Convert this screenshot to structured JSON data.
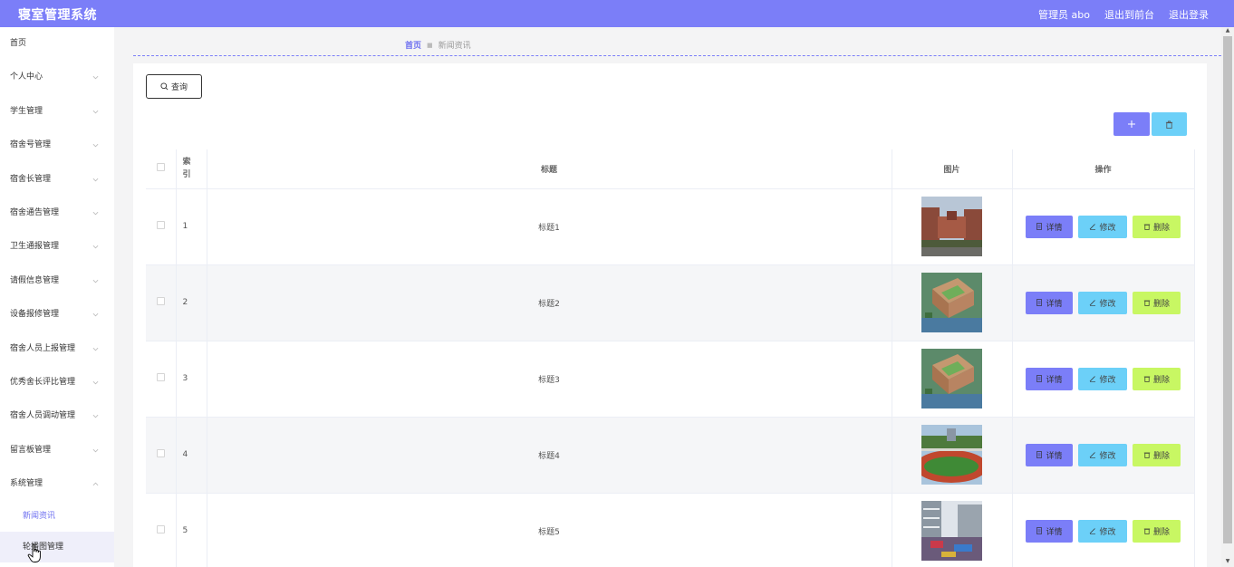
{
  "app": {
    "title": "寝室管理系统"
  },
  "header": {
    "user": "管理员 abo",
    "to_front": "退出到前台",
    "logout": "退出登录"
  },
  "sidebar": {
    "items": [
      {
        "label": "首页",
        "expandable": false
      },
      {
        "label": "个人中心",
        "expandable": true
      },
      {
        "label": "学生管理",
        "expandable": true
      },
      {
        "label": "宿舍号管理",
        "expandable": true
      },
      {
        "label": "宿舍长管理",
        "expandable": true
      },
      {
        "label": "宿舍通告管理",
        "expandable": true
      },
      {
        "label": "卫生通报管理",
        "expandable": true
      },
      {
        "label": "请假信息管理",
        "expandable": true
      },
      {
        "label": "设备报修管理",
        "expandable": true
      },
      {
        "label": "宿舍人员上报管理",
        "expandable": true
      },
      {
        "label": "优秀舍长评比管理",
        "expandable": true
      },
      {
        "label": "宿舍人员调动管理",
        "expandable": true
      },
      {
        "label": "留言板管理",
        "expandable": true
      },
      {
        "label": "系统管理",
        "expandable": true,
        "expanded": true
      }
    ],
    "subitems": [
      {
        "label": "新闻资讯",
        "active": true
      },
      {
        "label": "轮播图管理",
        "hover": true
      }
    ]
  },
  "breadcrumb": {
    "home": "首页",
    "current": "新闻资讯"
  },
  "toolbar": {
    "search_label": "查询",
    "add_icon": "plus-icon",
    "delete_icon": "trash-icon"
  },
  "table": {
    "headers": {
      "index": "索\n引",
      "title": "标题",
      "image": "图片",
      "ops": "操作"
    },
    "rows": [
      {
        "index": "1",
        "title": "标题1",
        "image": "campus-building-photo"
      },
      {
        "index": "2",
        "title": "标题2",
        "image": "campus-aerial-render"
      },
      {
        "index": "3",
        "title": "标题3",
        "image": "campus-aerial-render"
      },
      {
        "index": "4",
        "title": "标题4",
        "image": "sports-field-photo"
      },
      {
        "index": "5",
        "title": "标题5",
        "image": "modern-building-photo"
      }
    ],
    "ops": {
      "detail": "详情",
      "edit": "修改",
      "delete": "删除"
    }
  },
  "colors": {
    "accent": "#7b7ef8",
    "info": "#6cd0f8",
    "warn": "#c8f763"
  }
}
